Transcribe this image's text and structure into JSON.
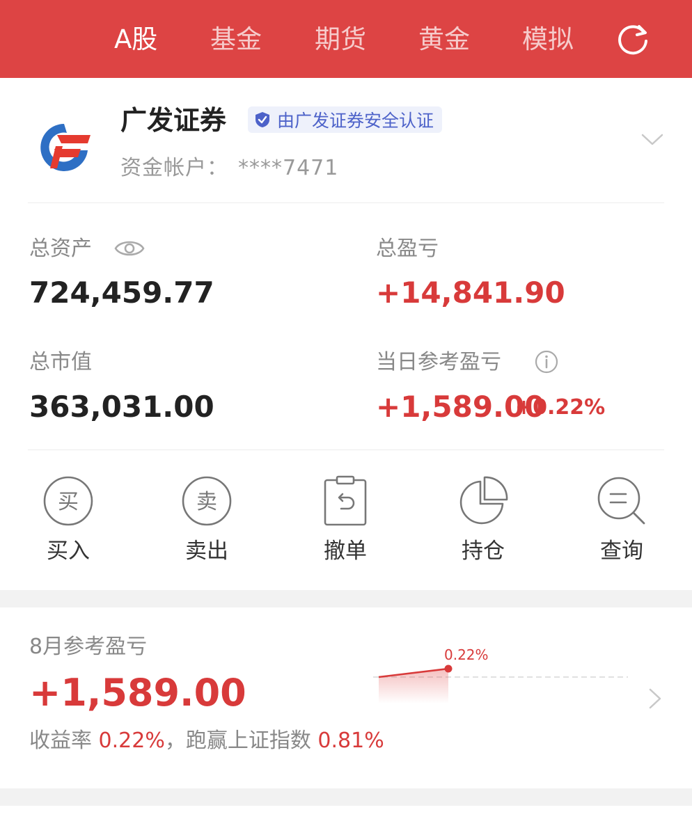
{
  "header": {
    "tabs": [
      {
        "label": "A股",
        "active": true
      },
      {
        "label": "基金",
        "active": false
      },
      {
        "label": "期货",
        "active": false
      },
      {
        "label": "黄金",
        "active": false
      },
      {
        "label": "模拟",
        "active": false
      }
    ],
    "refresh_icon": "refresh-icon",
    "bg_color": "#dd4444"
  },
  "account": {
    "broker_name": "广发证券",
    "cert_text": "由广发证券安全认证",
    "account_label": "资金帐户：",
    "account_masked": "****7471"
  },
  "summary": {
    "total_assets_label": "总资产",
    "total_assets": "724,459.77",
    "total_pnl_label": "总盈亏",
    "total_pnl": "+14,841.90",
    "market_value_label": "总市值",
    "market_value": "363,031.00",
    "daily_pnl_label": "当日参考盈亏",
    "daily_pnl": "+1,589.00",
    "daily_pct": "+0.22%"
  },
  "actions": [
    {
      "label": "买入",
      "icon_char": "买"
    },
    {
      "label": "卖出",
      "icon_char": "卖"
    },
    {
      "label": "撤单",
      "icon_char": ""
    },
    {
      "label": "持仓",
      "icon_char": ""
    },
    {
      "label": "查询",
      "icon_char": ""
    }
  ],
  "monthly": {
    "title": "8月参考盈亏",
    "value": "+1,589.00",
    "yield_label": "收益率",
    "yield_value": "0.22%",
    "separator": "，",
    "beat_label": "跑赢上证指数",
    "beat_value": "0.81%",
    "spark_label": "0.22%"
  },
  "colors": {
    "accent": "#d83a3a",
    "cert_blue": "#4d62c9"
  }
}
